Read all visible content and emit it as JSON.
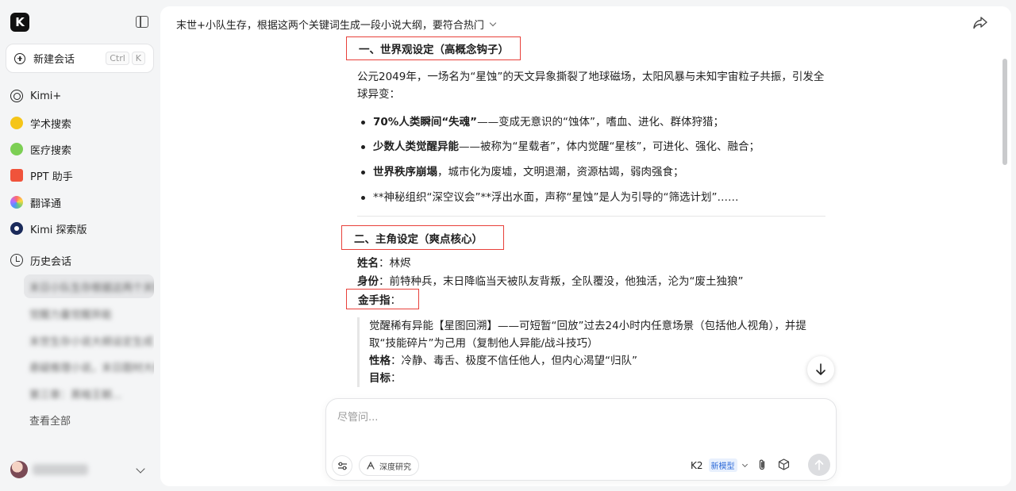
{
  "sidebar": {
    "logo": "K",
    "new_chat": {
      "label": "新建会话",
      "shortcut": [
        "Ctrl",
        "K"
      ]
    },
    "nav": [
      {
        "label": "Kimi+",
        "icon": "kimi-plus-icon"
      },
      {
        "label": "学术搜索",
        "icon": "academic-search-icon"
      },
      {
        "label": "医疗搜索",
        "icon": "medical-search-icon"
      },
      {
        "label": "PPT 助手",
        "icon": "ppt-icon"
      },
      {
        "label": "翻译通",
        "icon": "translate-icon"
      },
      {
        "label": "Kimi 探索版",
        "icon": "explore-icon"
      }
    ],
    "history_label": "历史会话",
    "history": [
      "末日小队生存根据这两个关键词生...",
      "觉醒力量觉醒异能",
      "末世生存小说大纲设定生成",
      "悬疑推理小说，末日题材大纲...",
      "第三章：黑暗王朝..."
    ],
    "see_all": "查看全部"
  },
  "header": {
    "title": "末世+小队生存，根据这两个关键词生成一段小说大纲，要符合热门"
  },
  "content": {
    "section1_heading": "一、世界观设定（高概念钩子）",
    "intro": "公元2049年，一场名为“星蚀”的天文异象撕裂了地球磁场，太阳风暴与未知宇宙粒子共振，引发全球异变：",
    "bullets": [
      {
        "bold": "70%人类瞬间“失魂”",
        "text": "——变成无意识的“蚀体”，嗜血、进化、群体狩猎；"
      },
      {
        "bold": "少数人类觉醒异能",
        "text": "——被称为“星载者”，体内觉醒“星核”，可进化、强化、融合；"
      },
      {
        "bold": "世界秩序崩塌",
        "text": "，城市化为废墟，文明退潮，资源枯竭，弱肉强食；"
      },
      {
        "bold": "",
        "text": "**神秘组织“深空议会”**浮出水面，声称“星蚀”是人为引导的“筛选计划”……"
      }
    ],
    "section2_heading": "二、主角设定（爽点核心）",
    "name_label": "姓名",
    "name_value": "：林烬",
    "identity_label": "身份",
    "identity_value": "：前特种兵，末日降临当天被队友背叛，全队覆没，他独活，沦为“废土独狼”",
    "cheat_label": "金手指",
    "cheat_colon": "：",
    "quote_line1": "觉醒稀有异能【星图回溯】——可短暂“回放”过去24小时内任意场景（包括他人视角），并提取“技能碎片”为己用（复制他人异能/战斗技巧）",
    "personality_label": "性格",
    "personality_value": "：冷静、毒舌、极度不信任他人，但内心渴望“归队”",
    "goal_label": "目标",
    "goal_colon": "："
  },
  "composer": {
    "placeholder": "尽管问...",
    "deep_research": "深度研究",
    "model": "K2",
    "model_badge": "新模型"
  }
}
